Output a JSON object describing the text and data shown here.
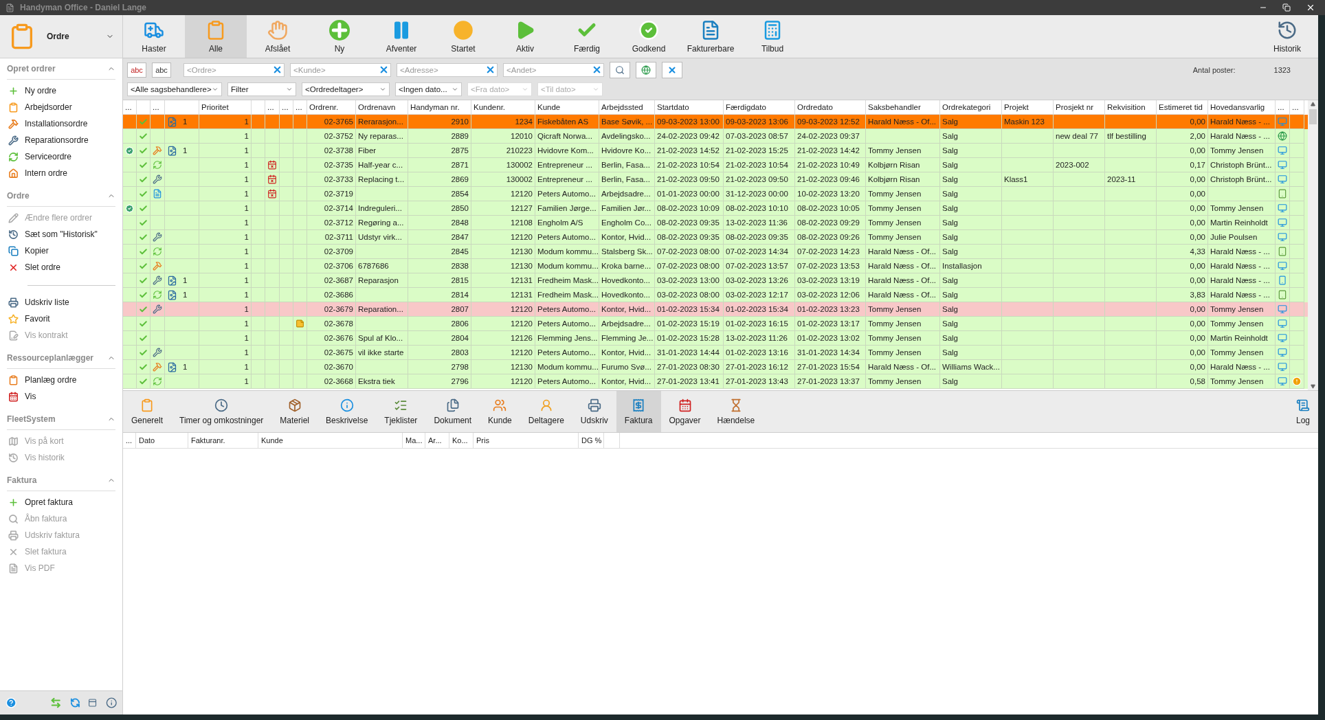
{
  "window": {
    "title": "Handyman Office - Daniel Lange"
  },
  "module": {
    "label": "Ordre"
  },
  "sidebar": {
    "sections": [
      {
        "title": "Opret ordrer",
        "expanded": true,
        "groups": [
          [
            {
              "label": "Ny ordre",
              "disabled": false
            },
            {
              "label": "Arbejdsorder",
              "disabled": false
            },
            {
              "label": "Installationsordre",
              "disabled": false
            },
            {
              "label": "Reparationsordre",
              "disabled": false
            },
            {
              "label": "Serviceordre",
              "disabled": false
            },
            {
              "label": "Intern ordre",
              "disabled": false
            }
          ]
        ]
      },
      {
        "title": "Ordre",
        "expanded": true,
        "groups": [
          [
            {
              "label": "Ændre flere ordrer",
              "disabled": true
            },
            {
              "label": "Sæt som \"Historisk\"",
              "disabled": false
            },
            {
              "label": "Kopier",
              "disabled": false
            },
            {
              "label": "Slet ordre",
              "disabled": false
            }
          ],
          [
            {
              "label": "Udskriv liste",
              "disabled": false
            },
            {
              "label": "Favorit",
              "disabled": false
            },
            {
              "label": "Vis kontrakt",
              "disabled": true
            }
          ]
        ]
      },
      {
        "title": "Ressourceplanlægger",
        "expanded": true,
        "groups": [
          [
            {
              "label": "Planlæg ordre",
              "disabled": false
            },
            {
              "label": "Vis",
              "disabled": false
            }
          ]
        ]
      },
      {
        "title": "FleetSystem",
        "expanded": true,
        "groups": [
          [
            {
              "label": "Vis på kort",
              "disabled": true
            },
            {
              "label": "Vis historik",
              "disabled": true
            }
          ]
        ]
      },
      {
        "title": "Faktura",
        "expanded": true,
        "groups": [
          [
            {
              "label": "Opret faktura",
              "disabled": false
            },
            {
              "label": "Åbn faktura",
              "disabled": true
            },
            {
              "label": "Udskriv faktura",
              "disabled": true
            },
            {
              "label": "Slet faktura",
              "disabled": true
            },
            {
              "label": "Vis PDF",
              "disabled": true
            }
          ]
        ]
      }
    ]
  },
  "toolbar": {
    "items": [
      {
        "label": "Haster",
        "selected": false
      },
      {
        "label": "Alle",
        "selected": true
      },
      {
        "label": "Afslået",
        "selected": false
      },
      {
        "label": "Ny",
        "selected": false
      },
      {
        "label": "Afventer",
        "selected": false
      },
      {
        "label": "Startet",
        "selected": false
      },
      {
        "label": "Aktiv",
        "selected": false
      },
      {
        "label": "Færdig",
        "selected": false
      },
      {
        "label": "Godkend",
        "selected": false
      },
      {
        "label": "Fakturerbare",
        "selected": false
      },
      {
        "label": "Tilbud",
        "selected": false
      }
    ],
    "history": "Historik"
  },
  "filters": {
    "text_buttons": [
      "abc",
      "abc"
    ],
    "fields": [
      {
        "placeholder": "<Ordre>"
      },
      {
        "placeholder": "<Kunde>"
      },
      {
        "placeholder": "<Adresse>"
      },
      {
        "placeholder": "<Andet>"
      }
    ],
    "count_label": "Antal poster:",
    "count": "1323",
    "dropdowns": [
      {
        "value": "<Alle sagsbehandlere>",
        "disabled": false
      },
      {
        "value": "Filter",
        "disabled": false
      },
      {
        "value": "<Ordredeltager>",
        "disabled": false
      },
      {
        "value": "<Ingen dato...",
        "disabled": false
      },
      {
        "value": "<Fra dato>",
        "disabled": true
      },
      {
        "value": "<Til dato>",
        "disabled": true
      }
    ]
  },
  "grid": {
    "lead_columns": [
      "...",
      "",
      "...",
      "",
      "Prioritet",
      "",
      "...",
      "...",
      "..."
    ],
    "columns": [
      "Ordrenr.",
      "Ordrenavn",
      "Handyman nr.",
      "Kundenr.",
      "Kunde",
      "Arbejdssted",
      "Startdato",
      "Færdigdato",
      "Ordredato",
      "Saksbehandler",
      "Ordrekategori",
      "Projekt",
      "Prosjekt nr",
      "Rekvisition",
      "Estimeret tid",
      "Hovedansvarlig"
    ],
    "tail_columns": [
      "...",
      "..."
    ],
    "rows": [
      {
        "selected": true,
        "highlighted": false,
        "info": false,
        "done": true,
        "kind": "plain",
        "attachments": "1",
        "priority": "1",
        "date_alert": false,
        "note": false,
        "cells": [
          "02-3765",
          "Rerarasjon...",
          "2910",
          "1234",
          "Fiskebåten AS",
          "Base Søvik, ...",
          "09-03-2023 13:00",
          "09-03-2023 13:06",
          "09-03-2023 12:52",
          "Harald Næss - Of...",
          "Salg",
          "Maskin 123",
          null,
          null,
          "0,00",
          "Harald Næss - ..."
        ],
        "device": {
          "kind": "pc"
        },
        "warning": false
      },
      {
        "selected": false,
        "highlighted": false,
        "info": false,
        "done": true,
        "kind": "plain",
        "attachments": null,
        "priority": "1",
        "date_alert": false,
        "note": false,
        "cells": [
          "02-3752",
          "Ny reparas...",
          "2889",
          "12010",
          "Qicraft Norwa...",
          "Avdelingsko...",
          "24-02-2023 09:42",
          "07-03-2023 08:57",
          "24-02-2023 09:37",
          null,
          "Salg",
          null,
          "new deal 77",
          "tlf bestilling",
          "2,00",
          "Harald Næss - ..."
        ],
        "device": {
          "kind": "web"
        },
        "warning": false
      },
      {
        "selected": false,
        "highlighted": false,
        "info": true,
        "done": true,
        "kind": "installation",
        "attachments": "1",
        "priority": "1",
        "date_alert": false,
        "note": false,
        "cells": [
          "02-3738",
          "Fiber",
          "2875",
          "210223",
          "Hvidovre Kom...",
          "Hvidovre Ko...",
          "21-02-2023 14:52",
          "21-02-2023 15:25",
          "21-02-2023 14:42",
          "Tommy Jensen",
          "Salg",
          null,
          null,
          null,
          "0,00",
          "Tommy Jensen"
        ],
        "device": {
          "kind": "pc"
        },
        "warning": false
      },
      {
        "selected": false,
        "highlighted": false,
        "info": false,
        "done": true,
        "kind": "service",
        "attachments": null,
        "priority": "1",
        "date_alert": true,
        "note": false,
        "cells": [
          "02-3735",
          "Half-year c...",
          "2871",
          "130002",
          "Entrepreneur ...",
          "Berlin, Fasa...",
          "21-02-2023 10:54",
          "21-02-2023 10:54",
          "21-02-2023 10:49",
          "Kolbjørn Risan",
          "Salg",
          null,
          "2023-002",
          null,
          "0,17",
          "Christoph Brünt..."
        ],
        "device": {
          "kind": "pc"
        },
        "warning": false
      },
      {
        "selected": false,
        "highlighted": false,
        "info": false,
        "done": true,
        "kind": "repair",
        "attachments": null,
        "priority": "1",
        "date_alert": true,
        "note": false,
        "cells": [
          "02-3733",
          "Replacing t...",
          "2869",
          "130002",
          "Entrepreneur ...",
          "Berlin, Fasa...",
          "21-02-2023 09:50",
          "21-02-2023 09:50",
          "21-02-2023 09:46",
          "Kolbjørn Risan",
          "Salg",
          "Klass1",
          null,
          "2023-11",
          "0,00",
          "Christoph Brünt..."
        ],
        "device": {
          "kind": "pc"
        },
        "warning": false
      },
      {
        "selected": false,
        "highlighted": false,
        "info": false,
        "done": true,
        "kind": "document",
        "attachments": null,
        "priority": "1",
        "date_alert": true,
        "note": false,
        "cells": [
          "02-3719",
          null,
          "2854",
          "12120",
          "Peters Automo...",
          "Arbejdsadre...",
          "01-01-2023 00:00",
          "31-12-2023 00:00",
          "10-02-2023 13:20",
          "Tommy Jensen",
          "Salg",
          null,
          null,
          null,
          "0,00",
          null
        ],
        "device": {
          "kind": "tablet"
        },
        "warning": false
      },
      {
        "selected": false,
        "highlighted": false,
        "info": true,
        "done": true,
        "kind": "plain",
        "attachments": null,
        "priority": "1",
        "date_alert": false,
        "note": false,
        "cells": [
          "02-3714",
          "Indreguleri...",
          "2850",
          "12127",
          "Familien Jørge...",
          "Familien Jør...",
          "08-02-2023 10:09",
          "08-02-2023 10:10",
          "08-02-2023 10:05",
          "Tommy Jensen",
          "Salg",
          null,
          null,
          null,
          "0,00",
          "Tommy Jensen"
        ],
        "device": {
          "kind": "pc"
        },
        "warning": false
      },
      {
        "selected": false,
        "highlighted": false,
        "info": false,
        "done": true,
        "kind": "plain",
        "attachments": null,
        "priority": "1",
        "date_alert": false,
        "note": false,
        "cells": [
          "02-3712",
          "Regøring a...",
          "2848",
          "12108",
          "Engholm A/S",
          "Engholm Co...",
          "08-02-2023 09:35",
          "13-02-2023 11:36",
          "08-02-2023 09:29",
          "Tommy Jensen",
          "Salg",
          null,
          null,
          null,
          "0,00",
          "Martin Reinholdt"
        ],
        "device": {
          "kind": "pc"
        },
        "warning": false
      },
      {
        "selected": false,
        "highlighted": false,
        "info": false,
        "done": true,
        "kind": "repair",
        "attachments": null,
        "priority": "1",
        "date_alert": false,
        "note": false,
        "cells": [
          "02-3711",
          "Udstyr virk...",
          "2847",
          "12120",
          "Peters Automo...",
          "Kontor, Hvid...",
          "08-02-2023 09:35",
          "08-02-2023 09:35",
          "08-02-2023 09:26",
          "Tommy Jensen",
          "Salg",
          null,
          null,
          null,
          "0,00",
          "Julie Poulsen"
        ],
        "device": {
          "kind": "pc"
        },
        "warning": false
      },
      {
        "selected": false,
        "highlighted": false,
        "info": false,
        "done": true,
        "kind": "service",
        "attachments": null,
        "priority": "1",
        "date_alert": false,
        "note": false,
        "cells": [
          "02-3709",
          null,
          "2845",
          "12130",
          "Modum kommu...",
          "Stalsberg Sk...",
          "07-02-2023 08:00",
          "07-02-2023 14:34",
          "07-02-2023 14:23",
          "Harald Næss - Of...",
          "Salg",
          null,
          null,
          null,
          "4,33",
          "Harald Næss - ..."
        ],
        "device": {
          "kind": "tablet"
        },
        "warning": false
      },
      {
        "selected": false,
        "highlighted": false,
        "info": false,
        "done": true,
        "kind": "installation",
        "attachments": null,
        "priority": "1",
        "date_alert": false,
        "note": false,
        "cells": [
          "02-3706",
          "6787686",
          "2838",
          "12130",
          "Modum kommu...",
          "Kroka barne...",
          "07-02-2023 08:00",
          "07-02-2023 13:57",
          "07-02-2023 13:53",
          "Harald Næss - Of...",
          "Installasjon",
          null,
          null,
          null,
          "0,00",
          "Harald Næss - ..."
        ],
        "device": {
          "kind": "pc"
        },
        "warning": false
      },
      {
        "selected": false,
        "highlighted": false,
        "info": false,
        "done": true,
        "kind": "repair",
        "attachments": "1",
        "priority": "1",
        "date_alert": false,
        "note": false,
        "cells": [
          "02-3687",
          "Reparasjon",
          "2815",
          "12131",
          "Fredheim Mask...",
          "Hovedkonto...",
          "03-02-2023 13:00",
          "03-02-2023 13:26",
          "03-02-2023 13:19",
          "Harald Næss - Of...",
          "Salg",
          null,
          null,
          null,
          "0,00",
          "Harald Næss - ..."
        ],
        "device": {
          "kind": "phone"
        },
        "warning": false
      },
      {
        "selected": false,
        "highlighted": false,
        "info": false,
        "done": true,
        "kind": "service",
        "attachments": "1",
        "priority": "1",
        "date_alert": false,
        "note": false,
        "cells": [
          "02-3686",
          null,
          "2814",
          "12131",
          "Fredheim Mask...",
          "Hovedkonto...",
          "03-02-2023 08:00",
          "03-02-2023 12:17",
          "03-02-2023 12:06",
          "Harald Næss - Of...",
          "Salg",
          null,
          null,
          null,
          "3,83",
          "Harald Næss - ..."
        ],
        "device": {
          "kind": "tablet"
        },
        "warning": false
      },
      {
        "selected": false,
        "highlighted": true,
        "info": false,
        "done": true,
        "kind": "repair",
        "attachments": null,
        "priority": "1",
        "date_alert": false,
        "note": false,
        "cells": [
          "02-3679",
          "Reparation...",
          "2807",
          "12120",
          "Peters Automo...",
          "Kontor, Hvid...",
          "01-02-2023 15:34",
          "01-02-2023 15:34",
          "01-02-2023 13:23",
          "Tommy Jensen",
          "Salg",
          null,
          null,
          null,
          "0,00",
          "Tommy Jensen"
        ],
        "device": {
          "kind": "pc"
        },
        "warning": false
      },
      {
        "selected": false,
        "highlighted": false,
        "info": false,
        "done": true,
        "kind": "plain",
        "attachments": null,
        "priority": "1",
        "date_alert": false,
        "note": true,
        "cells": [
          "02-3678",
          null,
          "2806",
          "12120",
          "Peters Automo...",
          "Arbejdsadre...",
          "01-02-2023 15:19",
          "01-02-2023 16:15",
          "01-02-2023 13:17",
          "Tommy Jensen",
          "Salg",
          null,
          null,
          null,
          "0,00",
          "Tommy Jensen"
        ],
        "device": {
          "kind": "pc"
        },
        "warning": false
      },
      {
        "selected": false,
        "highlighted": false,
        "info": false,
        "done": true,
        "kind": "plain",
        "attachments": null,
        "priority": "1",
        "date_alert": false,
        "note": false,
        "cells": [
          "02-3676",
          "Spul af Klo...",
          "2804",
          "12126",
          "Flemming Jens...",
          "Flemming Je...",
          "01-02-2023 15:28",
          "13-02-2023 11:26",
          "01-02-2023 13:02",
          "Tommy Jensen",
          "Salg",
          null,
          null,
          null,
          "0,00",
          "Martin Reinholdt"
        ],
        "device": {
          "kind": "pc"
        },
        "warning": false
      },
      {
        "selected": false,
        "highlighted": false,
        "info": false,
        "done": true,
        "kind": "repair",
        "attachments": null,
        "priority": "1",
        "date_alert": false,
        "note": false,
        "cells": [
          "02-3675",
          "vil ikke starte",
          "2803",
          "12120",
          "Peters Automo...",
          "Kontor, Hvid...",
          "31-01-2023 14:44",
          "01-02-2023 13:16",
          "31-01-2023 14:34",
          "Tommy Jensen",
          "Salg",
          null,
          null,
          null,
          "0,00",
          "Tommy Jensen"
        ],
        "device": {
          "kind": "pc"
        },
        "warning": false
      },
      {
        "selected": false,
        "highlighted": false,
        "info": false,
        "done": true,
        "kind": "installation",
        "attachments": "1",
        "priority": "1",
        "date_alert": false,
        "note": false,
        "cells": [
          "02-3670",
          null,
          "2798",
          "12130",
          "Modum kommu...",
          "Furumo Svø...",
          "27-01-2023 08:30",
          "27-01-2023 16:12",
          "27-01-2023 15:54",
          "Harald Næss - Of...",
          "Williams Wack...",
          null,
          null,
          null,
          "0,00",
          "Harald Næss - ..."
        ],
        "device": {
          "kind": "pc"
        },
        "warning": false
      },
      {
        "selected": false,
        "highlighted": false,
        "info": false,
        "done": true,
        "kind": "service",
        "attachments": null,
        "priority": "1",
        "date_alert": false,
        "note": false,
        "cells": [
          "02-3668",
          "Ekstra tiek",
          "2796",
          "12120",
          "Peters Automo...",
          "Kontor, Hvid...",
          "27-01-2023 13:41",
          "27-01-2023 13:43",
          "27-01-2023 13:37",
          "Tommy Jensen",
          "Salg",
          null,
          null,
          null,
          "0,58",
          "Tommy Jensen"
        ],
        "device": {
          "kind": "pc"
        },
        "warning": true
      }
    ]
  },
  "detail_tabs": {
    "items": [
      {
        "label": "Generelt",
        "selected": false
      },
      {
        "label": "Timer og omkostninger",
        "selected": false
      },
      {
        "label": "Materiel",
        "selected": false
      },
      {
        "label": "Beskrivelse",
        "selected": false
      },
      {
        "label": "Tjeklister",
        "selected": false
      },
      {
        "label": "Dokument",
        "selected": false
      },
      {
        "label": "Kunde",
        "selected": false
      },
      {
        "label": "Deltagere",
        "selected": false
      },
      {
        "label": "Udskriv",
        "selected": false
      },
      {
        "label": "Faktura",
        "selected": true
      },
      {
        "label": "Opgaver",
        "selected": false
      },
      {
        "label": "Hændelse",
        "selected": false
      }
    ],
    "log": "Log"
  },
  "invoice_grid": {
    "columns": [
      "...",
      "Dato",
      "Fakturanr.",
      "Kunde",
      "Ma...",
      "Ar...",
      "Ko...",
      "Pris",
      "DG %"
    ]
  }
}
